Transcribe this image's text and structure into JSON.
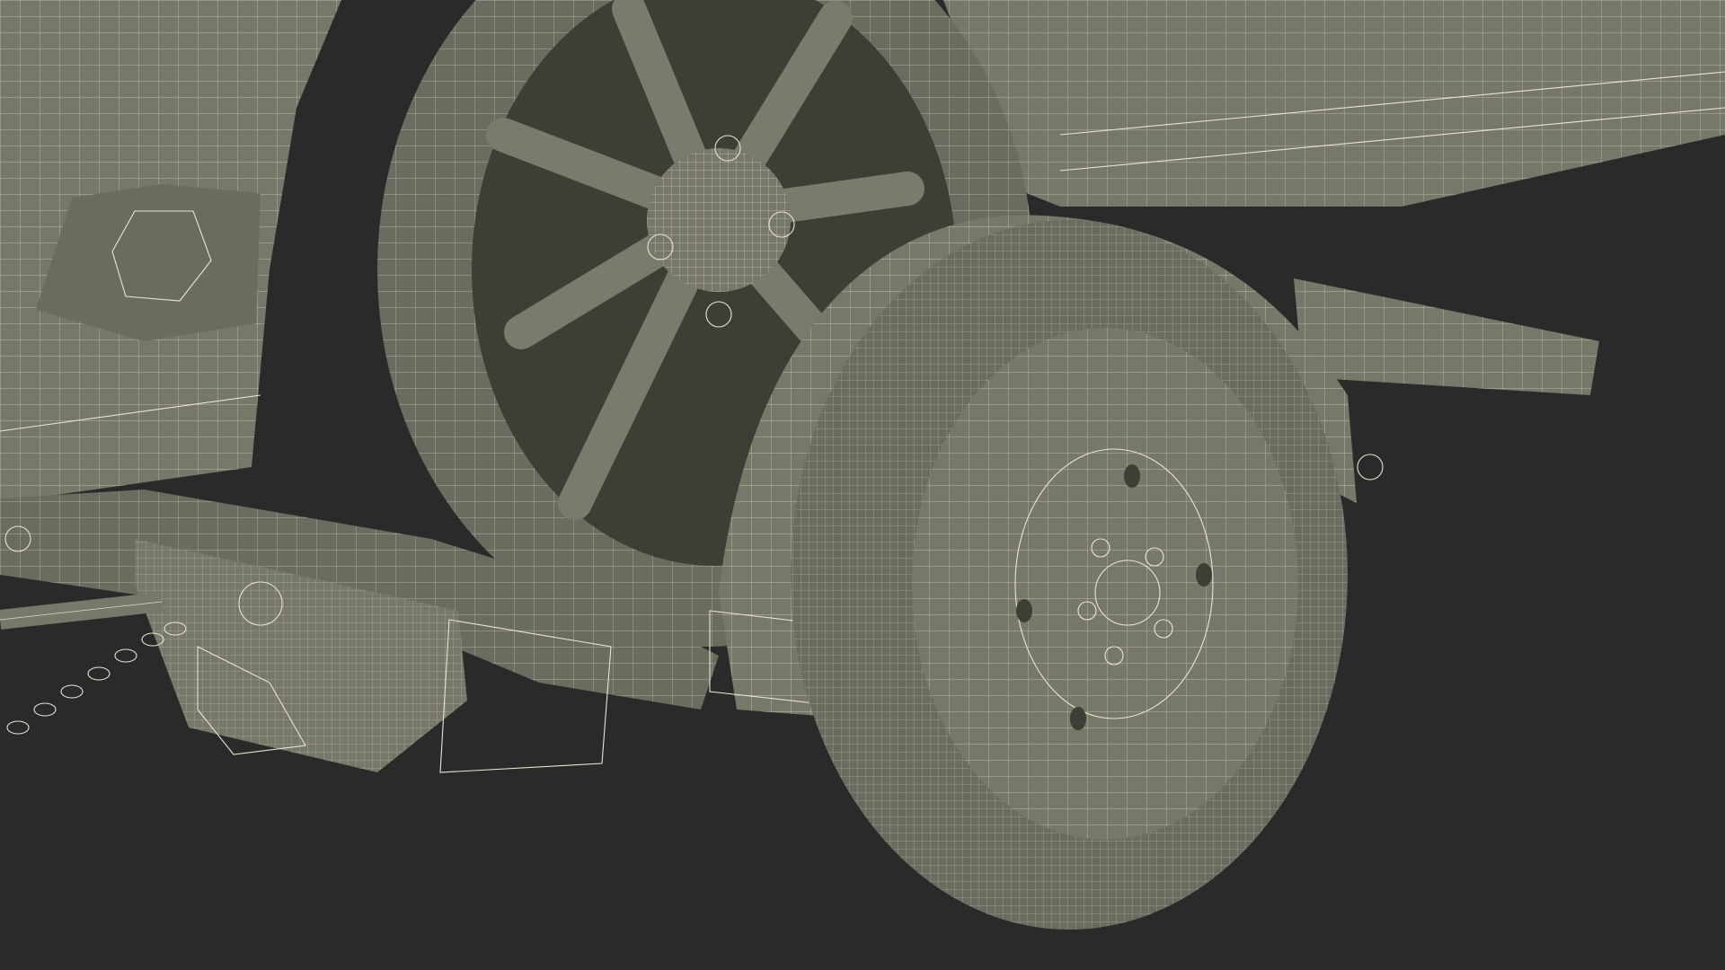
{
  "scene": {
    "background_color": "#2a2a2a",
    "mesh_fill": "#77776a",
    "mesh_fill_dark": "#5d5d52",
    "mesh_fill_shadow": "#3e3e36",
    "wire_color": "#e9e6d2"
  },
  "icons": {
    "car": "car-body-wireframe",
    "tire": "tire-wireframe",
    "dolly": "tow-dolly-wireframe",
    "chain": "chain-wireframe"
  }
}
